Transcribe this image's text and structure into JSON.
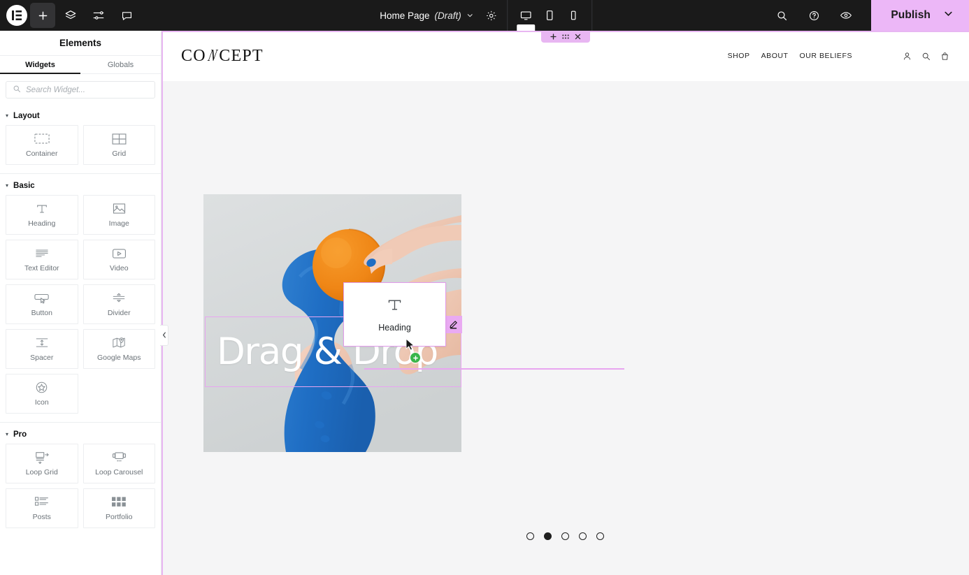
{
  "topbar": {
    "logo_icon": "elementor-logo-icon",
    "add_icon": "plus-icon",
    "layers_icon": "layers-icon",
    "settings_sliders_icon": "sliders-icon",
    "comments_icon": "comment-bubble-icon",
    "document_title": "Home Page",
    "document_status": "(Draft)",
    "document_caret_icon": "chevron-down-icon",
    "page_settings_icon": "gear-icon",
    "responsive": [
      {
        "name": "desktop",
        "icon": "desktop-icon",
        "active": true
      },
      {
        "name": "tablet",
        "icon": "tablet-icon",
        "active": false
      },
      {
        "name": "mobile",
        "icon": "mobile-icon",
        "active": false
      }
    ],
    "search_icon": "search-icon",
    "help_icon": "question-circle-icon",
    "preview_icon": "eye-icon",
    "publish_label": "Publish",
    "publish_caret_icon": "chevron-down-icon",
    "publish_color": "#ECB7F7",
    "bar_color": "#1a1a1a"
  },
  "panel": {
    "title": "Elements",
    "tabs": [
      {
        "label": "Widgets",
        "active": true
      },
      {
        "label": "Globals",
        "active": false
      }
    ],
    "search": {
      "placeholder": "Search Widget...",
      "value": "",
      "icon": "search-icon"
    },
    "categories": [
      {
        "title": "Layout",
        "caret": "▾",
        "widgets": [
          {
            "label": "Container",
            "icon": "container-icon"
          },
          {
            "label": "Grid",
            "icon": "grid-icon"
          }
        ]
      },
      {
        "title": "Basic",
        "caret": "▾",
        "widgets": [
          {
            "label": "Heading",
            "icon": "heading-t-icon"
          },
          {
            "label": "Image",
            "icon": "image-icon"
          },
          {
            "label": "Text Editor",
            "icon": "text-lines-icon"
          },
          {
            "label": "Video",
            "icon": "video-play-icon"
          },
          {
            "label": "Button",
            "icon": "button-cursor-icon"
          },
          {
            "label": "Divider",
            "icon": "divider-icon"
          },
          {
            "label": "Spacer",
            "icon": "spacer-icon"
          },
          {
            "label": "Google Maps",
            "icon": "map-pin-icon"
          },
          {
            "label": "Icon",
            "icon": "star-circle-icon"
          }
        ]
      },
      {
        "title": "Pro",
        "caret": "▾",
        "widgets": [
          {
            "label": "Loop Grid",
            "icon": "loop-grid-icon"
          },
          {
            "label": "Loop Carousel",
            "icon": "loop-carousel-icon"
          },
          {
            "label": "Posts",
            "icon": "posts-list-icon"
          },
          {
            "label": "Portfolio",
            "icon": "portfolio-grid-icon"
          }
        ]
      }
    ],
    "collapse_icon": "chevron-left-icon"
  },
  "canvas": {
    "section_toolbar": {
      "add_icon": "plus-icon",
      "drag_icon": "drag-handle-dots-icon",
      "close_icon": "close-x-icon",
      "color": "#e8b6f2"
    },
    "site_header": {
      "brand_part1": "CO",
      "brand_slash": "N",
      "brand_part2": "CEPT",
      "nav": [
        {
          "label": "SHOP"
        },
        {
          "label": "ABOUT"
        },
        {
          "label": "OUR BELIEFS"
        }
      ],
      "icons": [
        {
          "name": "account-person-icon"
        },
        {
          "name": "search-icon"
        },
        {
          "name": "cart-bag-icon"
        }
      ]
    },
    "hero": {
      "image_alt": "blue-painted-hands-holding-orange",
      "overlay_heading": "Drag & Drop",
      "edit_icon": "pencil-edit-icon",
      "highlight_color": "#e8a5f0"
    },
    "drag_ghost": {
      "label": "Heading",
      "icon": "heading-t-icon",
      "border_color": "#e29bec"
    },
    "drop_indicator": {
      "icon": "plus-circle-icon",
      "color": "#39b54a"
    },
    "cursor": {
      "icon": "mouse-pointer-icon"
    },
    "carousel_dots": [
      {
        "active": false
      },
      {
        "active": true
      },
      {
        "active": false
      },
      {
        "active": false
      },
      {
        "active": false
      }
    ]
  }
}
